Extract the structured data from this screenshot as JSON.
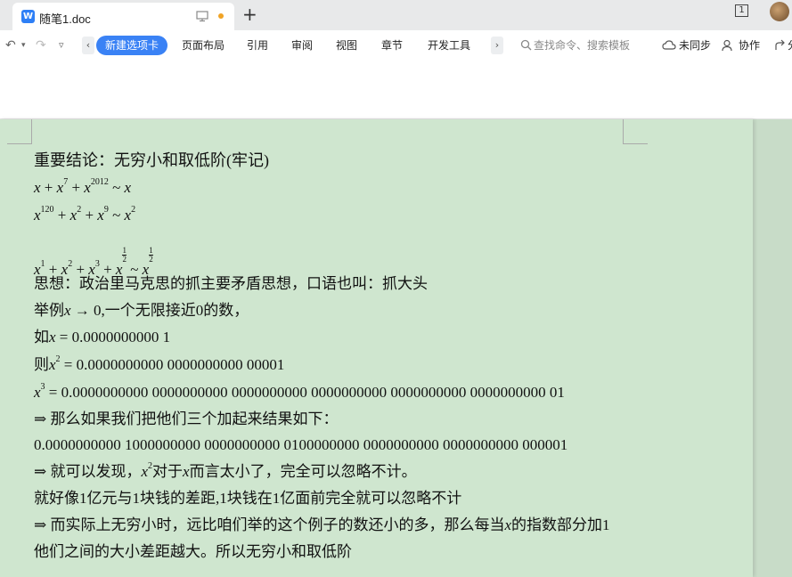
{
  "tab": {
    "logo": "W",
    "title": "随笔1.doc",
    "new_tab": "+"
  },
  "window": {
    "count": "1"
  },
  "toolbar": {
    "undo": "↶",
    "undo_more": "▾",
    "redo": "↷",
    "qa_more": "▿",
    "scroll_left": "‹",
    "active_tab": "新建选项卡",
    "items": [
      "页面布局",
      "引用",
      "审阅",
      "视图",
      "章节",
      "开发工具"
    ],
    "scroll_right": "›",
    "search_placeholder": "查找命令、搜索模板",
    "sync": "未同步",
    "collab": "协作",
    "share": "分"
  },
  "document": {
    "lines": {
      "l1": "重要结论：无穷小和取低阶(牢记)",
      "l6": "思想：政治里马克思的抓主要矛盾思想，口语也叫：抓大头",
      "l7a": "举例",
      "l7b": "x",
      "l7c": " → 0,",
      "l7d": "一个无限接近0的数，",
      "l8a": "如",
      "l8b": "x",
      "l8c": " = 0.0000000000 1",
      "l9a": "则",
      "l9b": "x",
      "l9c": "2",
      "l9d": " = 0.0000000000 0000000000 00001",
      "l10a": "x",
      "l10b": "3",
      "l10c": " = 0.0000000000 0000000000 0000000000 0000000000 0000000000 0000000000 01",
      "l11": "⇒ 那么如果我们把他们三个加起来结果如下：",
      "l12": "0.0000000000 1000000000 0000000000 0100000000 0000000000 0000000000 000001",
      "l13a": "⇒ 就可以发现，",
      "l13b": "x",
      "l13c": "2",
      "l13d": "对于",
      "l13e": "x",
      "l13f": "而言太小了，完全可以忽略不计。",
      "l14": "就好像1亿元与1块钱的差距,1块钱在1亿面前完全就可以忽略不计",
      "l15a": "⇒ 而实际上无穷小时，远比咱们举的这个例子的数还小的多，那么每当",
      "l15b": "x",
      "l15c": "的指数部分加1",
      "l16": "他们之间的大小差距越大。所以无穷小和取低阶"
    },
    "formulas": {
      "f1": {
        "x": "x",
        "plus": " + ",
        "e7": "7",
        "e2012": "2012",
        "sim": " ~ "
      },
      "f2": {
        "x": "x",
        "e120": "120",
        "e2": "2",
        "e9": "9",
        "plus": " + ",
        "sim": " ~ "
      },
      "f3": {
        "x": "x",
        "e1": "1",
        "e2": "2",
        "e3": "3",
        "num": "1",
        "den": "2",
        "plus": " + ",
        "sim": " ~ "
      }
    }
  },
  "colors": {
    "page_bg": "#cfe6cf",
    "active_tab": "#3a82f5",
    "logo": "#2e7ff6",
    "unsaved_dot": "#f0a325"
  }
}
